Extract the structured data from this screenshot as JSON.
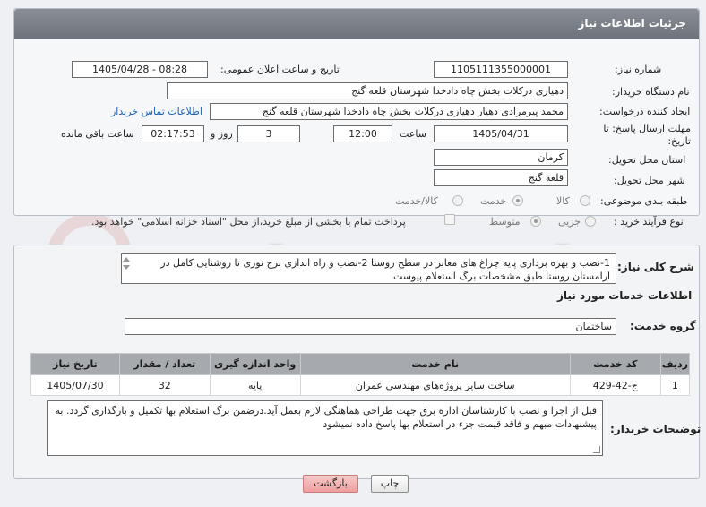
{
  "panel": {
    "title": "جزئیات اطلاعات نیاز"
  },
  "fields": {
    "need_number_label": "شماره نیاز:",
    "need_number": "1105111355000001",
    "announce_label": "تاریخ و ساعت اعلان عمومی:",
    "announce_value": "1405/04/28 - 08:28",
    "buyer_org_label": "نام دستگاه خریدار:",
    "buyer_org": "دهیاری درکلات بخش چاه دادخدا شهرستان قلعه گنج",
    "creator_label": "ایجاد کننده درخواست:",
    "creator": "محمد پیرمرادی دهیار دهیاری درکلات بخش چاه دادخدا شهرستان قلعه گنج",
    "contact_link": "اطلاعات تماس خریدار",
    "deadline_label": "مهلت ارسال پاسخ: تا تاریخ:",
    "deadline_date": "1405/04/31",
    "time_label": "ساعت",
    "deadline_time": "12:00",
    "days_value": "3",
    "days_label": "روز و",
    "remaining_time": "02:17:53",
    "remaining_label": "ساعت باقی مانده",
    "province_label": "استان محل تحویل:",
    "province": "کرمان",
    "city_label": "شهر محل تحویل:",
    "city": "قلعه گنج",
    "category_label": "طبقه بندی موضوعی:",
    "category_options": [
      "کالا",
      "خدمت",
      "کالا/خدمت"
    ],
    "category_selected": "خدمت",
    "process_label": "نوع فرآیند خرید :",
    "process_options": [
      "جزیی",
      "متوسط"
    ],
    "process_selected": "متوسط",
    "payment_note": "پرداخت تمام یا بخشی از مبلغ خرید،از محل \"اسناد خزانه اسلامی\" خواهد بود."
  },
  "summary": {
    "label": "شرح کلی نیاز:",
    "text": "1-نصب و بهره برداری پایه چراغ های معابر در سطح روستا 2-نصب و راه اندازی برج نوری تا روشنایی کامل در آرامستان روستا طبق مشخصات برگ استعلام پیوست"
  },
  "services": {
    "section_title": "اطلاعات خدمات مورد نیاز",
    "group_label": "گروه خدمت:",
    "group_value": "ساختمان",
    "columns": [
      "ردیف",
      "کد خدمت",
      "نام خدمت",
      "واحد اندازه گیری",
      "تعداد / مقدار",
      "تاریخ نیاز"
    ],
    "rows": [
      {
        "row": "1",
        "code": "ج-42-429",
        "name": "ساخت سایر پروژه‌های مهندسی عمران",
        "unit": "پایه",
        "qty": "32",
        "date": "1405/07/30"
      }
    ]
  },
  "notes": {
    "label": "توضیحات خریدار:",
    "text": "قبل از اجرا و نصب با کارشناسان اداره برق جهت طراحی هماهنگی لازم بعمل آید.درضمن برگ استعلام بها تکمیل و بارگذاری گردد. به پیشنهادات مبهم و فاقد قیمت جزء در استعلام بها پاسخ داده نمیشود"
  },
  "buttons": {
    "print": "چاپ",
    "back": "بازگشت"
  },
  "watermark": "AriaTender.neT",
  "colors": {
    "header": "#7a7f87",
    "link": "#1b5fb5",
    "back_button": "#ef9f9f",
    "table_header": "#a6a9ae"
  }
}
